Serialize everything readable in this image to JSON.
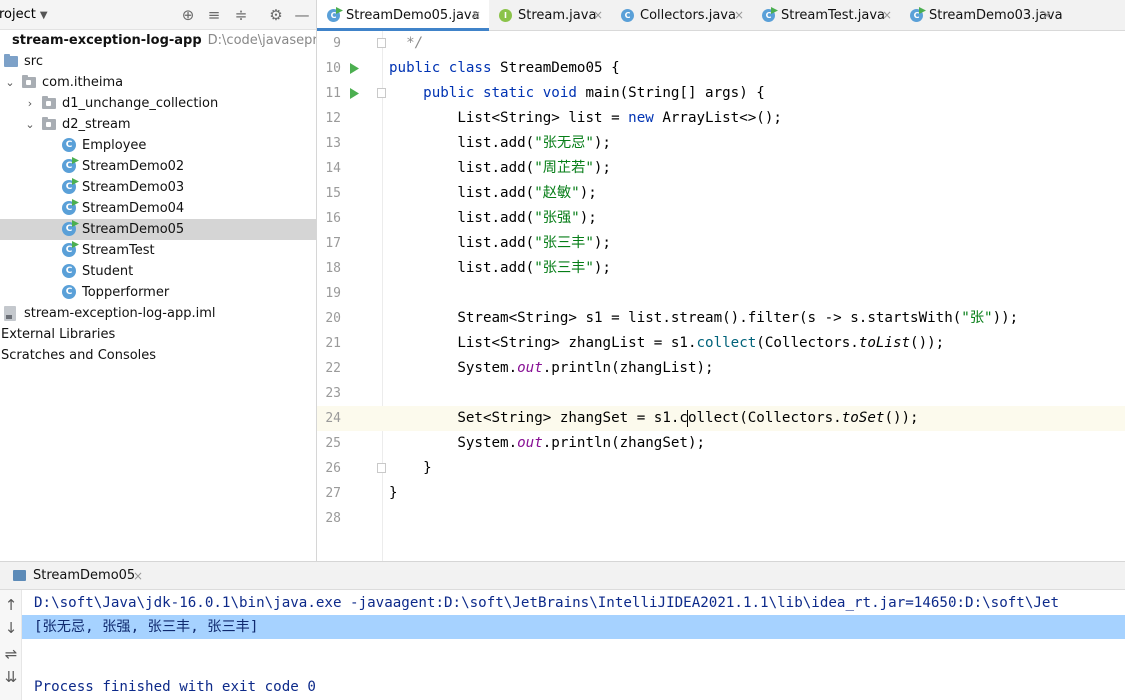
{
  "project_panel": {
    "title": "roject",
    "tree": [
      {
        "label": "stream-exception-log-app",
        "path": "D:\\code\\javasepromax",
        "kind": "module",
        "depth": 0,
        "bold": true,
        "arrow": ""
      },
      {
        "label": "src",
        "kind": "folder-blue",
        "depth": 0,
        "arrow": ""
      },
      {
        "label": "com.itheima",
        "kind": "package",
        "depth": 1,
        "arrow": "down"
      },
      {
        "label": "d1_unchange_collection",
        "kind": "package",
        "depth": 2,
        "arrow": "right"
      },
      {
        "label": "d2_stream",
        "kind": "package",
        "depth": 2,
        "arrow": "down"
      },
      {
        "label": "Employee",
        "kind": "class",
        "depth": 3,
        "arrow": ""
      },
      {
        "label": "StreamDemo02",
        "kind": "class-run",
        "depth": 3,
        "arrow": ""
      },
      {
        "label": "StreamDemo03",
        "kind": "class-run",
        "depth": 3,
        "arrow": ""
      },
      {
        "label": "StreamDemo04",
        "kind": "class-run",
        "depth": 3,
        "arrow": ""
      },
      {
        "label": "StreamDemo05",
        "kind": "class-run",
        "depth": 3,
        "arrow": "",
        "selected": true
      },
      {
        "label": "StreamTest",
        "kind": "class-run",
        "depth": 3,
        "arrow": ""
      },
      {
        "label": "Student",
        "kind": "class",
        "depth": 3,
        "arrow": ""
      },
      {
        "label": "Topperformer",
        "kind": "class",
        "depth": 3,
        "arrow": ""
      },
      {
        "label": "stream-exception-log-app.iml",
        "kind": "file",
        "depth": 0,
        "arrow": ""
      },
      {
        "label": "External Libraries",
        "kind": "plain",
        "depth": -1,
        "arrow": ""
      },
      {
        "label": "Scratches and Consoles",
        "kind": "plain",
        "depth": -1,
        "arrow": ""
      }
    ]
  },
  "editor": {
    "tabs": [
      {
        "label": "StreamDemo05.java",
        "icon": "class-run",
        "active": true,
        "close": "×"
      },
      {
        "label": "Stream.java",
        "icon": "interface",
        "active": false,
        "close": "×"
      },
      {
        "label": "Collectors.java",
        "icon": "class-lib",
        "active": false,
        "close": "×"
      },
      {
        "label": "StreamTest.java",
        "icon": "class-run",
        "active": false,
        "close": "×"
      },
      {
        "label": "StreamDemo03.java",
        "icon": "class-run",
        "active": false,
        "close": "×"
      }
    ],
    "current_line": 24,
    "lines": [
      {
        "num": "9",
        "run": false,
        "fold": true,
        "tokens": [
          {
            "t": "  */",
            "c": "cmt"
          }
        ]
      },
      {
        "num": "10",
        "run": true,
        "fold": false,
        "tokens": [
          {
            "t": "public class ",
            "c": "kw"
          },
          {
            "t": "StreamDemo05 {",
            "c": ""
          }
        ]
      },
      {
        "num": "11",
        "run": true,
        "fold": true,
        "tokens": [
          {
            "t": "    public static void ",
            "c": "kw"
          },
          {
            "t": "main(String[] args) {",
            "c": ""
          }
        ]
      },
      {
        "num": "12",
        "run": false,
        "fold": false,
        "tokens": [
          {
            "t": "        List<String> list = ",
            "c": ""
          },
          {
            "t": "new ",
            "c": "kw"
          },
          {
            "t": "ArrayList<>();",
            "c": ""
          }
        ]
      },
      {
        "num": "13",
        "run": false,
        "fold": false,
        "tokens": [
          {
            "t": "        list.add(",
            "c": ""
          },
          {
            "t": "\"张无忌\"",
            "c": "str"
          },
          {
            "t": ");",
            "c": ""
          }
        ]
      },
      {
        "num": "14",
        "run": false,
        "fold": false,
        "tokens": [
          {
            "t": "        list.add(",
            "c": ""
          },
          {
            "t": "\"周芷若\"",
            "c": "str"
          },
          {
            "t": ");",
            "c": ""
          }
        ]
      },
      {
        "num": "15",
        "run": false,
        "fold": false,
        "tokens": [
          {
            "t": "        list.add(",
            "c": ""
          },
          {
            "t": "\"赵敏\"",
            "c": "str"
          },
          {
            "t": ");",
            "c": ""
          }
        ]
      },
      {
        "num": "16",
        "run": false,
        "fold": false,
        "tokens": [
          {
            "t": "        list.add(",
            "c": ""
          },
          {
            "t": "\"张强\"",
            "c": "str"
          },
          {
            "t": ");",
            "c": ""
          }
        ]
      },
      {
        "num": "17",
        "run": false,
        "fold": false,
        "tokens": [
          {
            "t": "        list.add(",
            "c": ""
          },
          {
            "t": "\"张三丰\"",
            "c": "str"
          },
          {
            "t": ");",
            "c": ""
          }
        ]
      },
      {
        "num": "18",
        "run": false,
        "fold": false,
        "tokens": [
          {
            "t": "        list.add(",
            "c": ""
          },
          {
            "t": "\"张三丰\"",
            "c": "str"
          },
          {
            "t": ");",
            "c": ""
          }
        ]
      },
      {
        "num": "19",
        "run": false,
        "fold": false,
        "tokens": []
      },
      {
        "num": "20",
        "run": false,
        "fold": false,
        "tokens": [
          {
            "t": "        Stream<String> s1 = list.stream().filter(s -> s.startsWith(",
            "c": ""
          },
          {
            "t": "\"张\"",
            "c": "str"
          },
          {
            "t": "));",
            "c": ""
          }
        ]
      },
      {
        "num": "21",
        "run": false,
        "fold": false,
        "tokens": [
          {
            "t": "        List<String> zhangList = s1.",
            "c": ""
          },
          {
            "t": "collect",
            "c": "method-call"
          },
          {
            "t": "(Collectors.",
            "c": ""
          },
          {
            "t": "toList",
            "c": "static-m"
          },
          {
            "t": "());",
            "c": ""
          }
        ]
      },
      {
        "num": "22",
        "run": false,
        "fold": false,
        "tokens": [
          {
            "t": "        System.",
            "c": ""
          },
          {
            "t": "out",
            "c": "static-field"
          },
          {
            "t": ".println(zhangList);",
            "c": ""
          }
        ]
      },
      {
        "num": "23",
        "run": false,
        "fold": false,
        "tokens": []
      },
      {
        "num": "24",
        "run": false,
        "fold": false,
        "tokens": [
          {
            "t": "        Set<String> zhangSet = s1.c",
            "c": ""
          },
          {
            "t": "",
            "c": "caret"
          },
          {
            "t": "ollect",
            "c": ""
          },
          {
            "t": "(Collectors.",
            "c": ""
          },
          {
            "t": "toSet",
            "c": "static-m"
          },
          {
            "t": "());",
            "c": ""
          }
        ]
      },
      {
        "num": "25",
        "run": false,
        "fold": false,
        "tokens": [
          {
            "t": "        System.",
            "c": ""
          },
          {
            "t": "out",
            "c": "static-field"
          },
          {
            "t": ".println(zhangSet);",
            "c": ""
          }
        ]
      },
      {
        "num": "26",
        "run": false,
        "fold": true,
        "tokens": [
          {
            "t": "    }",
            "c": ""
          }
        ]
      },
      {
        "num": "27",
        "run": false,
        "fold": false,
        "tokens": [
          {
            "t": "}",
            "c": ""
          }
        ]
      },
      {
        "num": "28",
        "run": false,
        "fold": false,
        "tokens": []
      }
    ]
  },
  "run_panel": {
    "tab_label": "StreamDemo05",
    "tab_close": "×",
    "toolbar": [
      {
        "name": "scroll-up-icon",
        "glyph": "↑"
      },
      {
        "name": "scroll-down-icon",
        "glyph": "↓"
      },
      {
        "name": "soft-wrap-icon",
        "glyph": "⇌"
      },
      {
        "name": "scroll-to-end-icon",
        "glyph": "⇊"
      }
    ],
    "console": [
      {
        "text": "D:\\soft\\Java\\jdk-16.0.1\\bin\\java.exe -javaagent:D:\\soft\\JetBrains\\IntelliJIDEA2021.1.1\\lib\\idea_rt.jar=14650:D:\\soft\\Jet",
        "selected": false
      },
      {
        "text": "[张无忌, 张强, 张三丰, 张三丰]",
        "selected": true
      },
      {
        "text": "",
        "selected": false
      },
      {
        "text": "Process finished with exit code 0",
        "selected": false
      }
    ]
  }
}
